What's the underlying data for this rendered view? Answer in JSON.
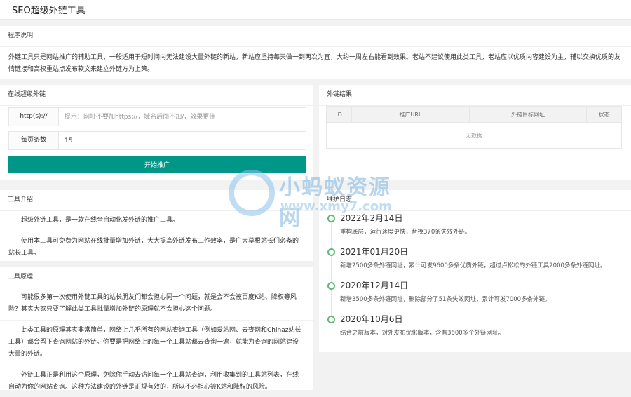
{
  "header": {
    "title": "SEO超级外链工具"
  },
  "program": {
    "title": "程序说明",
    "text": "外链工具只是网站推广的辅助工具，一般适用于短时间内无法建设大量外链的新站，新站应坚持每天做一到两次为宜，大约一周左右能看到效果。老站不建议使用此类工具，老站应以优质内容建设为主，辅以交换优质的友情链接和高权重站点发布软文来建立外链方为上策。"
  },
  "online": {
    "title": "在线超级外链",
    "url_label": "http(s)://",
    "url_placeholder": "提示：网址不要加https://，域名后面不加/，效果更佳",
    "url_value": "",
    "per_page_label": "每页条数",
    "per_page_value": "15",
    "start_button": "开始推广"
  },
  "results": {
    "title": "外链结果",
    "columns": [
      "ID",
      "推广URL",
      "外链目标网址",
      "状态"
    ],
    "empty": "无数据"
  },
  "intro": {
    "title": "工具介绍",
    "p1": "超级外链工具，是一款在线全自动化发外链的推广工具。",
    "p2": "使用本工具可免费为网站在线批量增加外链，大大提高外链发布工作效率，是广大草根站长们必备的站长工具。"
  },
  "principle": {
    "title": "工具原理",
    "p1": "可能很多第一次使用外链工具的站长朋友们都会担心同一个问题，就是会不会被百度K站、降权等风险？其实大家只要了解此类工具批量增加外链的原理就不会担心这个问题。",
    "p2": "此类工具的原理其实非常简单，网络上几乎所有的网站查询工具（例如爱站网、去查网和Chinaz站长工具）都会留下查询网站的外链。你要是把网络上的每一个工具站都去查询一遍，就能为查询的网站建设大量的外链。",
    "p3": "外链工具正是利用这个原理，免除你手动去访问每一个工具站查询，利用收集到的工具站列表，在线自动为你的网站查询。这种方法建设的外链是正规有效的，所以不必担心被K站和降权的风险。"
  },
  "maintenance": {
    "title": "维护日志",
    "items": [
      {
        "date": "2022年2月14日",
        "text": "重构底层，运行速度更快，替换370条失效外链。"
      },
      {
        "date": "2021年01月20日",
        "text": "新增2500多条外链网址，累计可发9600多条优质外链，超过卢松松的外链工具2000多条外链网址。"
      },
      {
        "date": "2020年12月14日",
        "text": "新增3500多条外链网址，删除部分了51条失效网址，累计可发7000多条外链。"
      },
      {
        "date": "2020年10月6日",
        "text": "结合之前版本，对外发布优化版本，含有3600多个外链网址。"
      }
    ]
  },
  "watermark": {
    "title": "小蚂蚁资源网",
    "url": "www.xmy7.com"
  },
  "colors": {
    "accent": "#009688",
    "timeline_dot": "#5fb878",
    "background": "#f2f2f2"
  }
}
